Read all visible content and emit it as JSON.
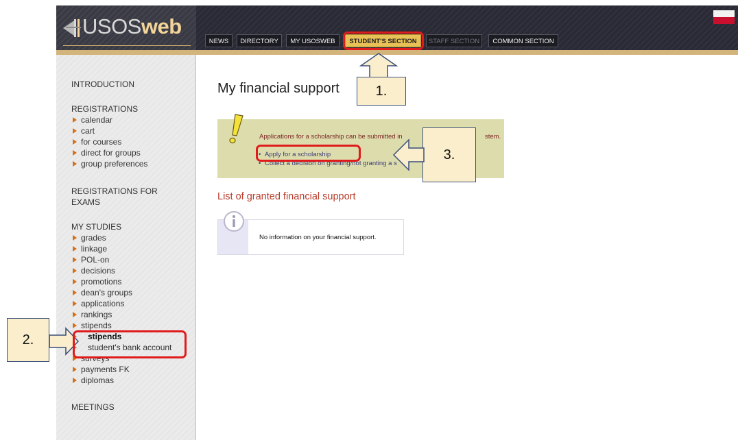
{
  "header": {
    "logo_text_1": "USOS",
    "logo_text_2": "web",
    "tabs": [
      {
        "label": "NEWS"
      },
      {
        "label": "DIRECTORY"
      },
      {
        "label": "MY USOSWEB"
      },
      {
        "label": "STUDENT'S SECTION"
      },
      {
        "label": "STAFF SECTION"
      },
      {
        "label": "COMMON SECTION"
      }
    ]
  },
  "sidebar": {
    "introduction": "INTRODUCTION",
    "registrations": "REGISTRATIONS",
    "reg_items": [
      "calendar",
      "cart",
      "for courses",
      "direct for groups",
      "group preferences"
    ],
    "registrations_exams_1": "REGISTRATIONS FOR",
    "registrations_exams_2": "EXAMS",
    "my_studies": "MY STUDIES",
    "study_items": [
      "grades",
      "linkage",
      "POL-on",
      "decisions",
      "promotions",
      "dean's groups",
      "applications",
      "rankings",
      "stipends",
      "stipends",
      "student's bank account",
      "surveys",
      "payments FK",
      "diplomas"
    ],
    "meetings": "MEETINGS"
  },
  "main": {
    "title": "My financial support",
    "notice_text": "Applications for a scholarship can be submitted in",
    "notice_text_end": "stem.",
    "notice_items": [
      "Apply for a scholarship",
      "Collect a decision on granting/not granting a s"
    ],
    "list_title": "List of granted financial support",
    "info_text": "No information on your financial support."
  },
  "annotations": {
    "step1": "1.",
    "step2": "2.",
    "step3": "3."
  },
  "colors": {
    "header_bg": "#2a2a36",
    "active_tab": "#e9c257",
    "callout_fill": "#fbeecd",
    "highlight_red": "#e01b1b",
    "notice_bg": "#dcdcac",
    "section_title": "#b83b2a"
  }
}
